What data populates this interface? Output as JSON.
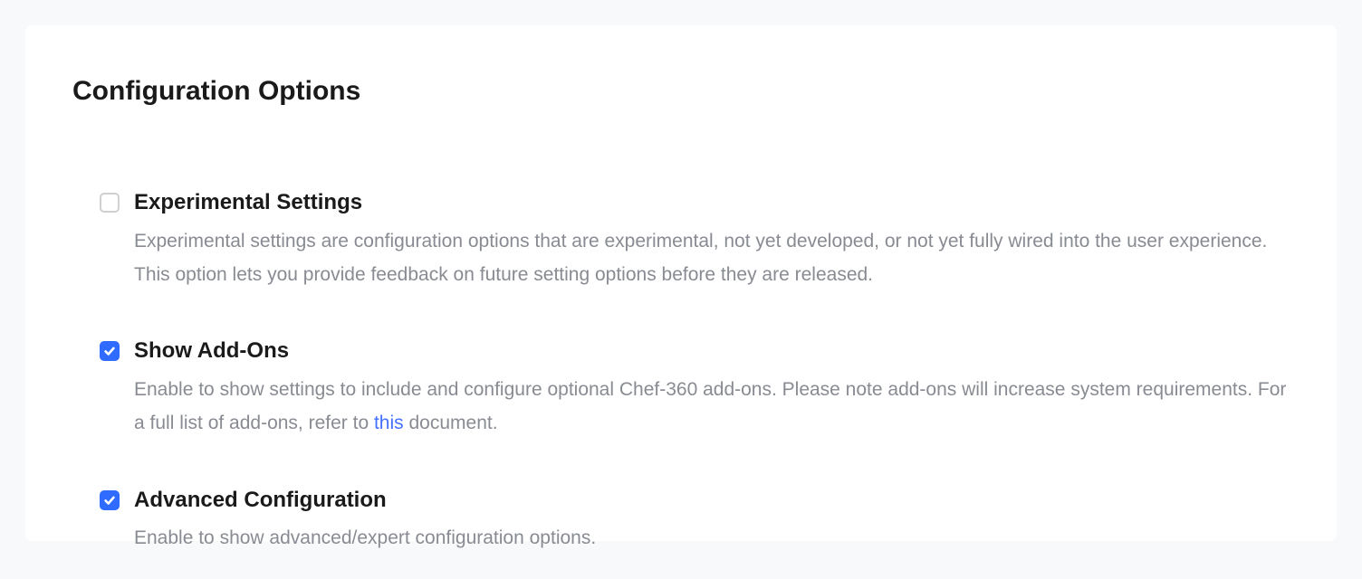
{
  "title": "Configuration Options",
  "options": [
    {
      "key": "experimental-settings",
      "checked": false,
      "label": "Experimental Settings",
      "desc": "Experimental settings are configuration options that are experimental, not yet developed, or not yet fully wired into the user experience. This option lets you provide feedback on future setting options before they are released."
    },
    {
      "key": "show-add-ons",
      "checked": true,
      "label": "Show Add-Ons",
      "desc_prefix": "Enable to show settings to include and configure optional Chef-360 add-ons. Please note add-ons will increase system requirements. For a full list of add-ons, refer to ",
      "link_text": "this",
      "desc_suffix": " document."
    },
    {
      "key": "advanced-configuration",
      "checked": true,
      "label": "Advanced Configuration",
      "desc": "Enable to show advanced/expert configuration options."
    }
  ]
}
